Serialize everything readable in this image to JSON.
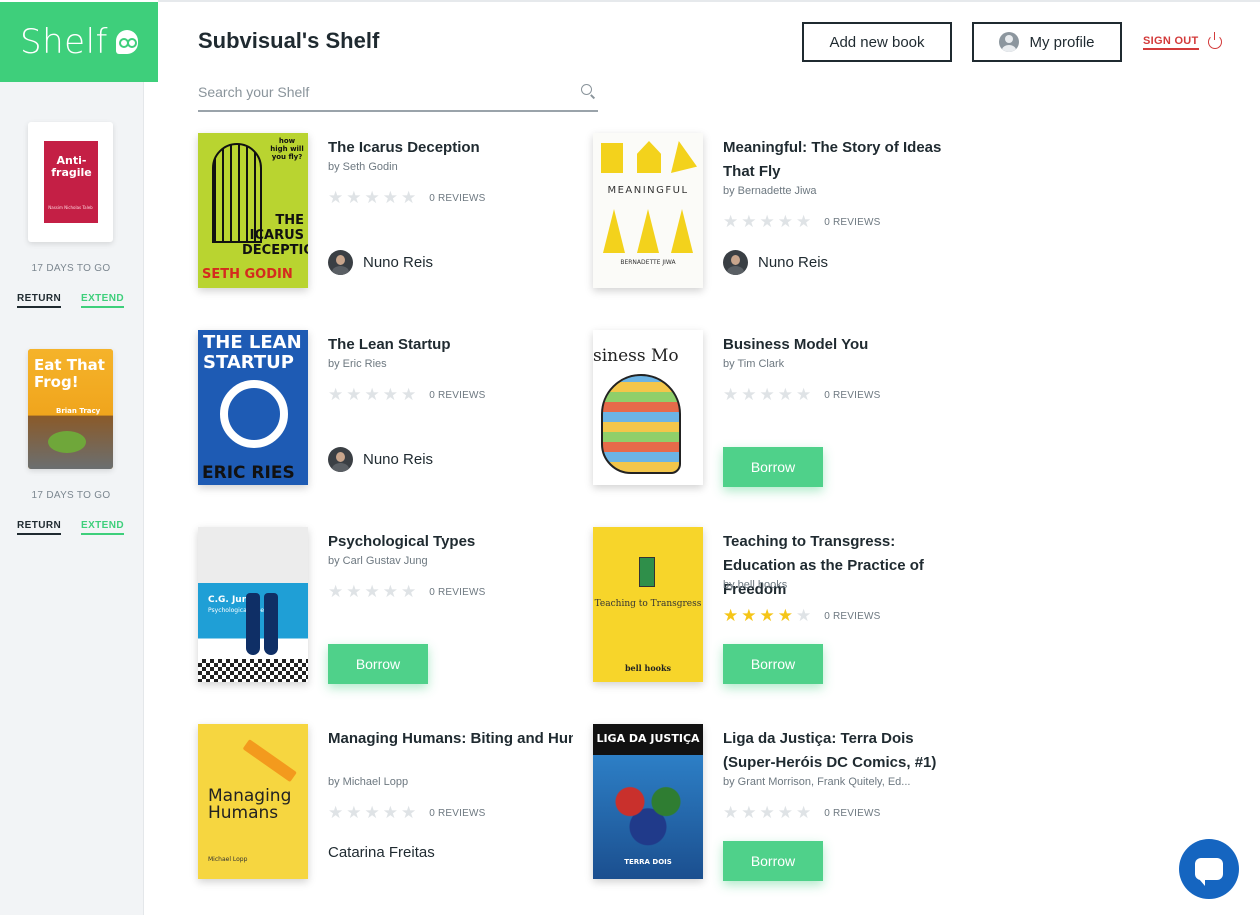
{
  "brand": {
    "logo_text": "Shelf",
    "accent": "#3ecf7b"
  },
  "header": {
    "title": "Subvisual's Shelf",
    "add_book_label": "Add new book",
    "profile_label": "My profile",
    "signout_label": "SIGN OUT"
  },
  "search": {
    "placeholder": "Search your Shelf",
    "value": ""
  },
  "sidebar": {
    "loans": [
      {
        "cover_title": "Anti-fragile",
        "cover_author": "Nassim Nicholas Taleb",
        "days_left": "17 DAYS TO GO",
        "return_label": "RETURN",
        "extend_label": "EXTEND"
      },
      {
        "cover_title": "Eat That Frog!",
        "cover_author": "Brian Tracy",
        "days_left": "17 DAYS TO GO",
        "return_label": "RETURN",
        "extend_label": "EXTEND"
      }
    ]
  },
  "books": [
    {
      "title": "The Icarus Deception",
      "author": "by Seth Godin",
      "rating": 0,
      "reviews": "0 REVIEWS",
      "owner": "Nuno Reis",
      "borrow_label": null,
      "cover_title": "THE ICARUS DECEPTION",
      "cover_author": "SETH GODIN",
      "cover_tag": "how high will you fly?"
    },
    {
      "title": "Meaningful: The Story of Ideas That Fly",
      "author": "by Bernadette Jiwa",
      "rating": 0,
      "reviews": "0 REVIEWS",
      "owner": "Nuno Reis",
      "borrow_label": null,
      "cover_title": "MEANINGFUL",
      "cover_author": "BERNADETTE JIWA"
    },
    {
      "title": "The Lean Startup",
      "author": "by Eric Ries",
      "rating": 0,
      "reviews": "0 REVIEWS",
      "owner": "Nuno Reis",
      "borrow_label": null,
      "cover_title": "THE LEAN STARTUP",
      "cover_author": "ERIC RIES"
    },
    {
      "title": "Business Model You",
      "author": "by Tim Clark",
      "rating": 0,
      "reviews": "0 REVIEWS",
      "owner": null,
      "borrow_label": "Borrow",
      "cover_title": "siness Mo"
    },
    {
      "title": "Psychological Types",
      "author": "by Carl Gustav Jung",
      "rating": 0,
      "reviews": "0 REVIEWS",
      "owner": null,
      "borrow_label": "Borrow",
      "cover_title": "C.G. Jung",
      "cover_subtitle": "Psychological Types"
    },
    {
      "title": "Teaching to Transgress: Education as the Practice of Freedom",
      "author": "by bell hooks",
      "rating": 4,
      "reviews": "0 REVIEWS",
      "owner": null,
      "borrow_label": "Borrow",
      "cover_title": "Teaching to Transgress",
      "cover_author": "bell hooks"
    },
    {
      "title": "Managing Humans: Biting and Humorous Tales of a Software ...",
      "author": "by Michael Lopp",
      "rating": 0,
      "reviews": "0 REVIEWS",
      "owner": "Catarina Freitas",
      "borrow_label": null,
      "cover_title": "Managing Humans",
      "cover_author": "Michael Lopp"
    },
    {
      "title": "Liga da Justiça: Terra Dois (Super-Heróis DC Comics, #1)",
      "author": "by Grant Morrison, Frank Quitely, Ed...",
      "rating": 0,
      "reviews": "0 REVIEWS",
      "owner": null,
      "borrow_label": "Borrow",
      "cover_title": "LIGA DA JUSTIÇA",
      "cover_subtitle": "TERRA DOIS"
    }
  ],
  "colors": {
    "accent_green": "#4fd18a",
    "signout_red": "#d33a3a",
    "star_on": "#f5c518",
    "star_off": "#dfe3e6",
    "chat_blue": "#1565c0"
  }
}
